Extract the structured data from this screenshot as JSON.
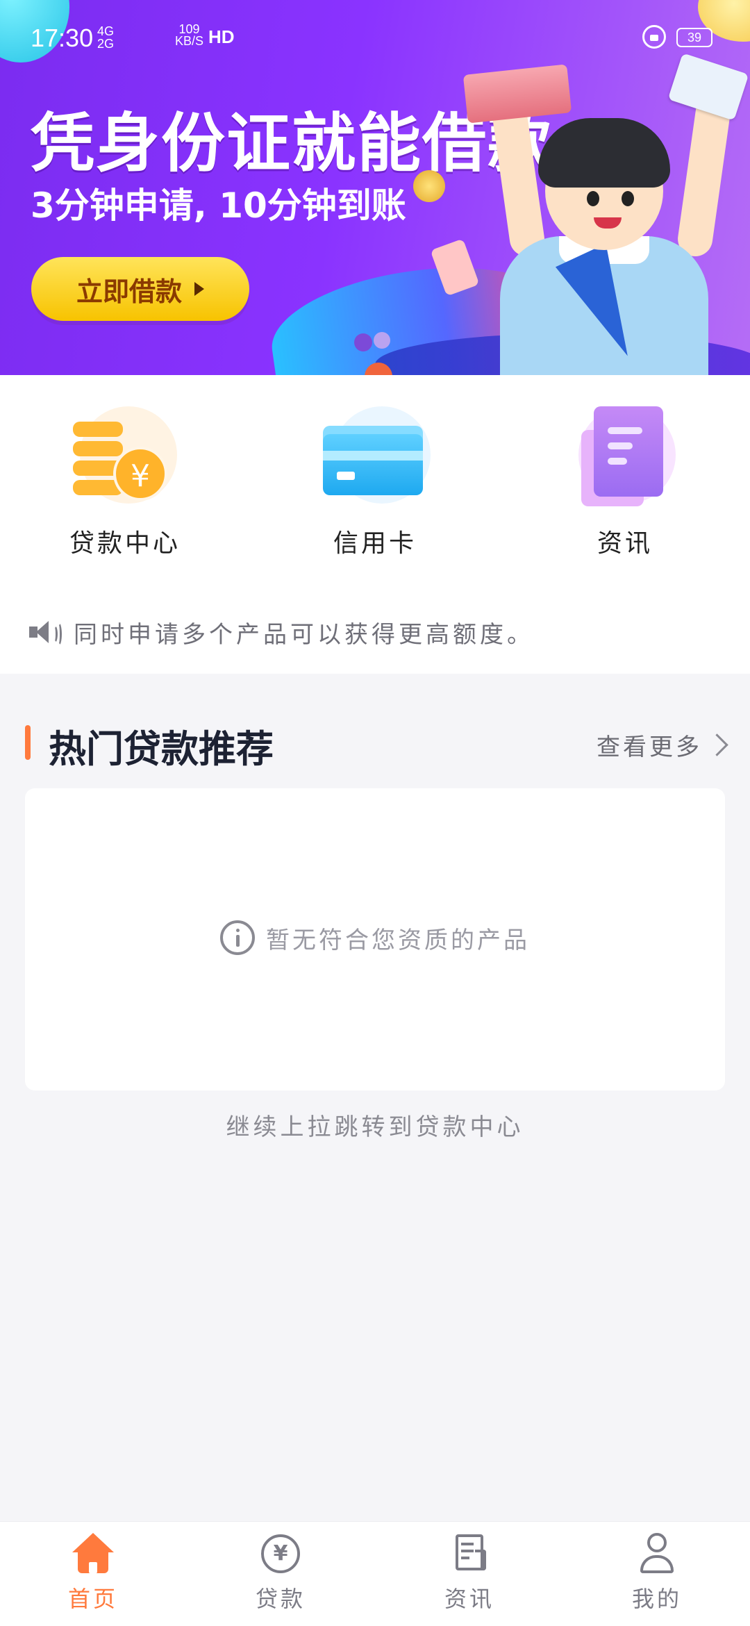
{
  "status_bar": {
    "time": "17:30",
    "network_1": "4G",
    "network_2": "2G",
    "speed_value": "109",
    "speed_unit": "KB/S",
    "hd": "HD",
    "battery": "39"
  },
  "banner": {
    "title": "凭身份证就能借款",
    "subtitle": "3分钟申请, 10分钟到账",
    "button_label": "立即借款"
  },
  "quick_entries": [
    {
      "label": "贷款中心",
      "icon": "coin-stack-icon"
    },
    {
      "label": "信用卡",
      "icon": "credit-card-icon"
    },
    {
      "label": "资讯",
      "icon": "document-icon"
    }
  ],
  "notice": {
    "icon": "speaker-icon",
    "text": "同时申请多个产品可以获得更高额度。"
  },
  "hot_loans": {
    "title": "热门贷款推荐",
    "more_label": "查看更多",
    "empty_text": "暂无符合您资质的产品",
    "pull_hint": "继续上拉跳转到贷款中心"
  },
  "tabbar": {
    "items": [
      {
        "label": "首页",
        "icon": "home-icon",
        "active": true
      },
      {
        "label": "贷款",
        "icon": "yen-icon",
        "active": false
      },
      {
        "label": "资讯",
        "icon": "news-icon",
        "active": false
      },
      {
        "label": "我的",
        "icon": "user-icon",
        "active": false
      }
    ]
  },
  "colors": {
    "accent": "#ff7a3d",
    "banner_start": "#7b2cf0",
    "banner_button": "#f7c300",
    "background": "#f5f5f8"
  }
}
